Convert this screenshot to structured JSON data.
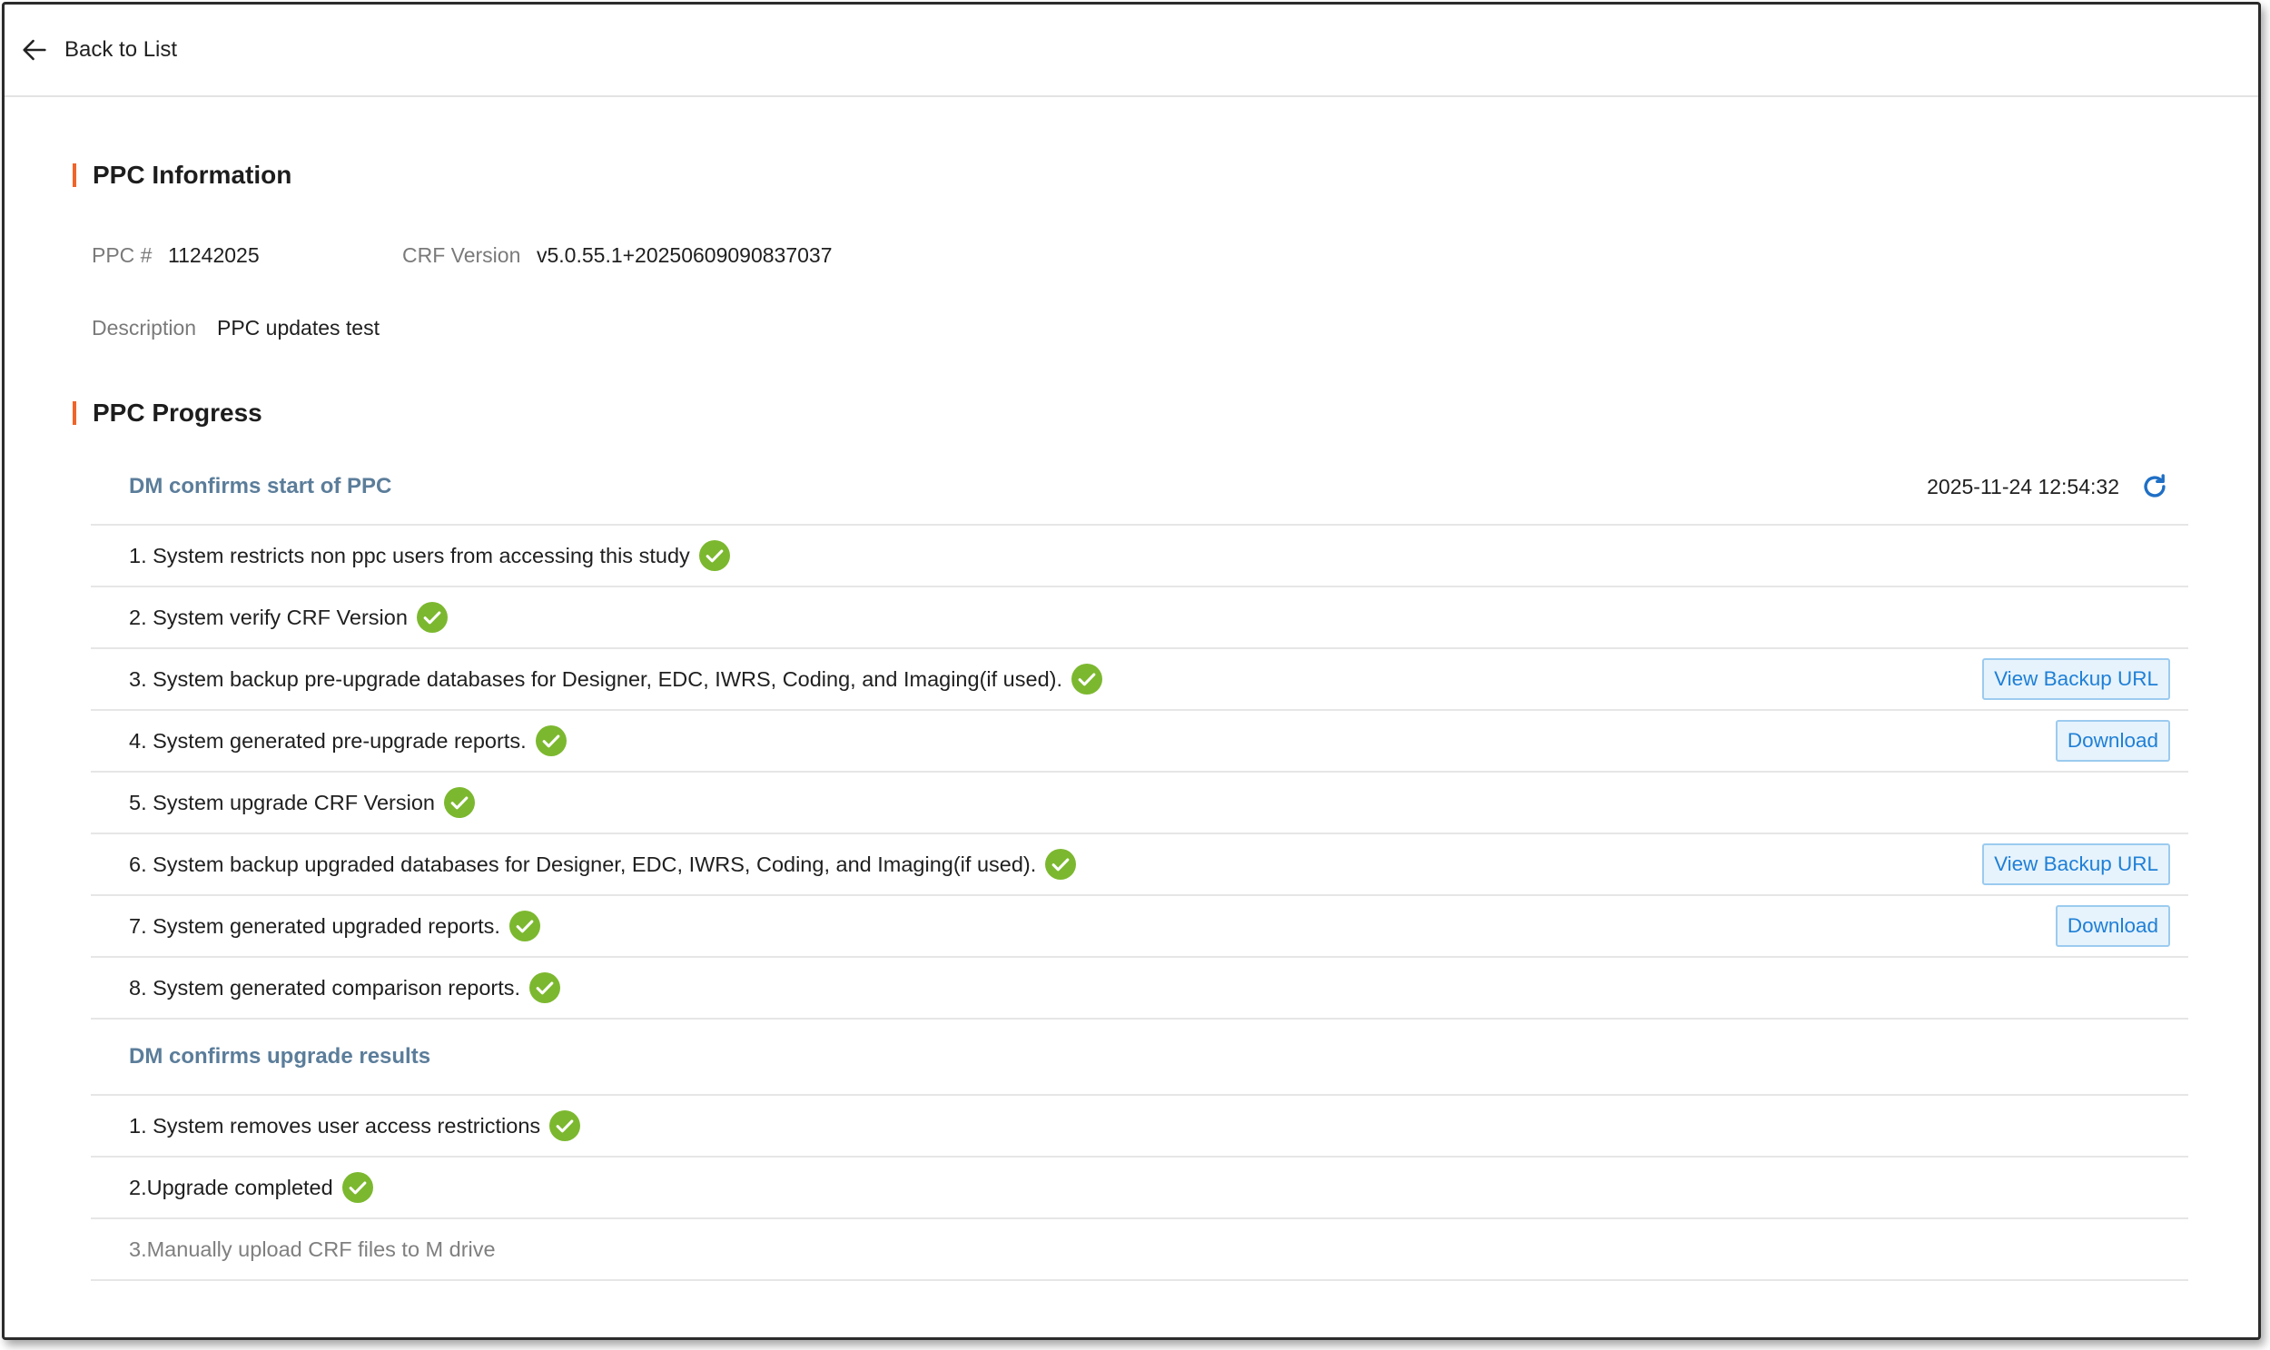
{
  "header": {
    "back_label": "Back to List"
  },
  "info": {
    "title": "PPC Information",
    "ppc_label": "PPC #",
    "ppc_value": "11242025",
    "crf_label": "CRF Version",
    "crf_value": "v5.0.55.1+20250609090837037",
    "desc_label": "Description",
    "desc_value": "PPC updates test"
  },
  "progress": {
    "title": "PPC Progress",
    "group1": {
      "title": "DM confirms start of PPC",
      "timestamp": "2025-11-24 12:54:32",
      "steps": [
        {
          "text": "1. System restricts non ppc users from accessing this study",
          "done": true
        },
        {
          "text": "2. System verify CRF Version",
          "done": true
        },
        {
          "text": "3. System backup pre-upgrade databases for Designer, EDC, IWRS, Coding, and Imaging(if used).",
          "done": true,
          "action": "View Backup URL"
        },
        {
          "text": "4. System generated pre-upgrade reports.",
          "done": true,
          "action": "Download"
        },
        {
          "text": "5. System upgrade CRF Version",
          "done": true
        },
        {
          "text": "6. System backup upgraded databases for Designer, EDC, IWRS, Coding, and Imaging(if used).",
          "done": true,
          "action": "View Backup URL"
        },
        {
          "text": "7. System generated upgraded reports.",
          "done": true,
          "action": "Download"
        },
        {
          "text": "8. System generated comparison reports.",
          "done": true
        }
      ]
    },
    "group2": {
      "title": "DM confirms upgrade results",
      "steps": [
        {
          "text": "1. System removes user access restrictions",
          "done": true
        },
        {
          "text": "2.Upgrade completed",
          "done": true
        },
        {
          "text": "3.Manually upload CRF files to M drive",
          "done": false
        }
      ]
    }
  },
  "colors": {
    "accent_bar": "#f0642a",
    "check_green": "#7cb82f",
    "group_title": "#5b7d9a",
    "button_blue": "#1f7fd6"
  },
  "icons": {
    "back": "arrow-left-icon",
    "check": "check-circle-icon",
    "refresh": "refresh-icon"
  }
}
